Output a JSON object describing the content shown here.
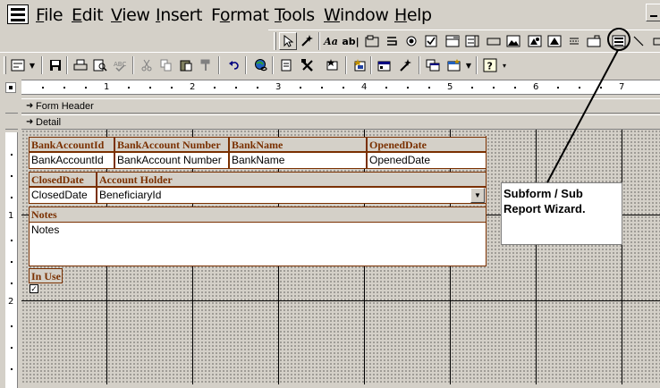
{
  "menu": {
    "items": [
      {
        "id": "file",
        "label": "File",
        "mnemonic": "F",
        "rest": "ile"
      },
      {
        "id": "edit",
        "label": "Edit",
        "mnemonic": "E",
        "rest": "dit"
      },
      {
        "id": "view",
        "label": "View",
        "mnemonic": "V",
        "rest": "iew"
      },
      {
        "id": "insert",
        "label": "Insert",
        "mnemonic": "I",
        "rest": "nsert"
      },
      {
        "id": "format",
        "label": "Format",
        "mnemonic": "o",
        "pre": "F",
        "rest": "rmat"
      },
      {
        "id": "tools",
        "label": "Tools",
        "mnemonic": "T",
        "rest": "ools"
      },
      {
        "id": "window",
        "label": "Window",
        "mnemonic": "W",
        "rest": "indow"
      },
      {
        "id": "help",
        "label": "Help",
        "mnemonic": "H",
        "rest": "elp"
      }
    ]
  },
  "toolbox": {
    "label_tool": "Aa",
    "textbox_tool": "ab|"
  },
  "ruler": {
    "numbers": [
      "1",
      "2",
      "3",
      "4",
      "5",
      "6",
      "7"
    ]
  },
  "vruler": {
    "numbers": [
      "1",
      "2"
    ]
  },
  "sections": {
    "form_header": "Form Header",
    "detail": "Detail"
  },
  "form": {
    "labels": {
      "bank_account_id": "BankAccountId",
      "bank_account_number": "BankAccount Number",
      "bank_name": "BankName",
      "opened_date": "OpenedDate",
      "closed_date": "ClosedDate",
      "account_holder": "Account Holder",
      "notes": "Notes",
      "in_use": "In Use"
    },
    "fields": {
      "bank_account_id": "BankAccountId",
      "bank_account_number": "BankAccount Number",
      "bank_name": "BankName",
      "opened_date": "OpenedDate",
      "closed_date": "ClosedDate",
      "beneficiary_id": "BeneficiaryId",
      "notes": "Notes",
      "in_use_checked": "✓"
    }
  },
  "callout": {
    "text": "Subform / Sub Report Wizard."
  },
  "colors": {
    "chrome": "#d4d0c8",
    "label_text": "#7a3000",
    "callout_line": "#000000"
  }
}
